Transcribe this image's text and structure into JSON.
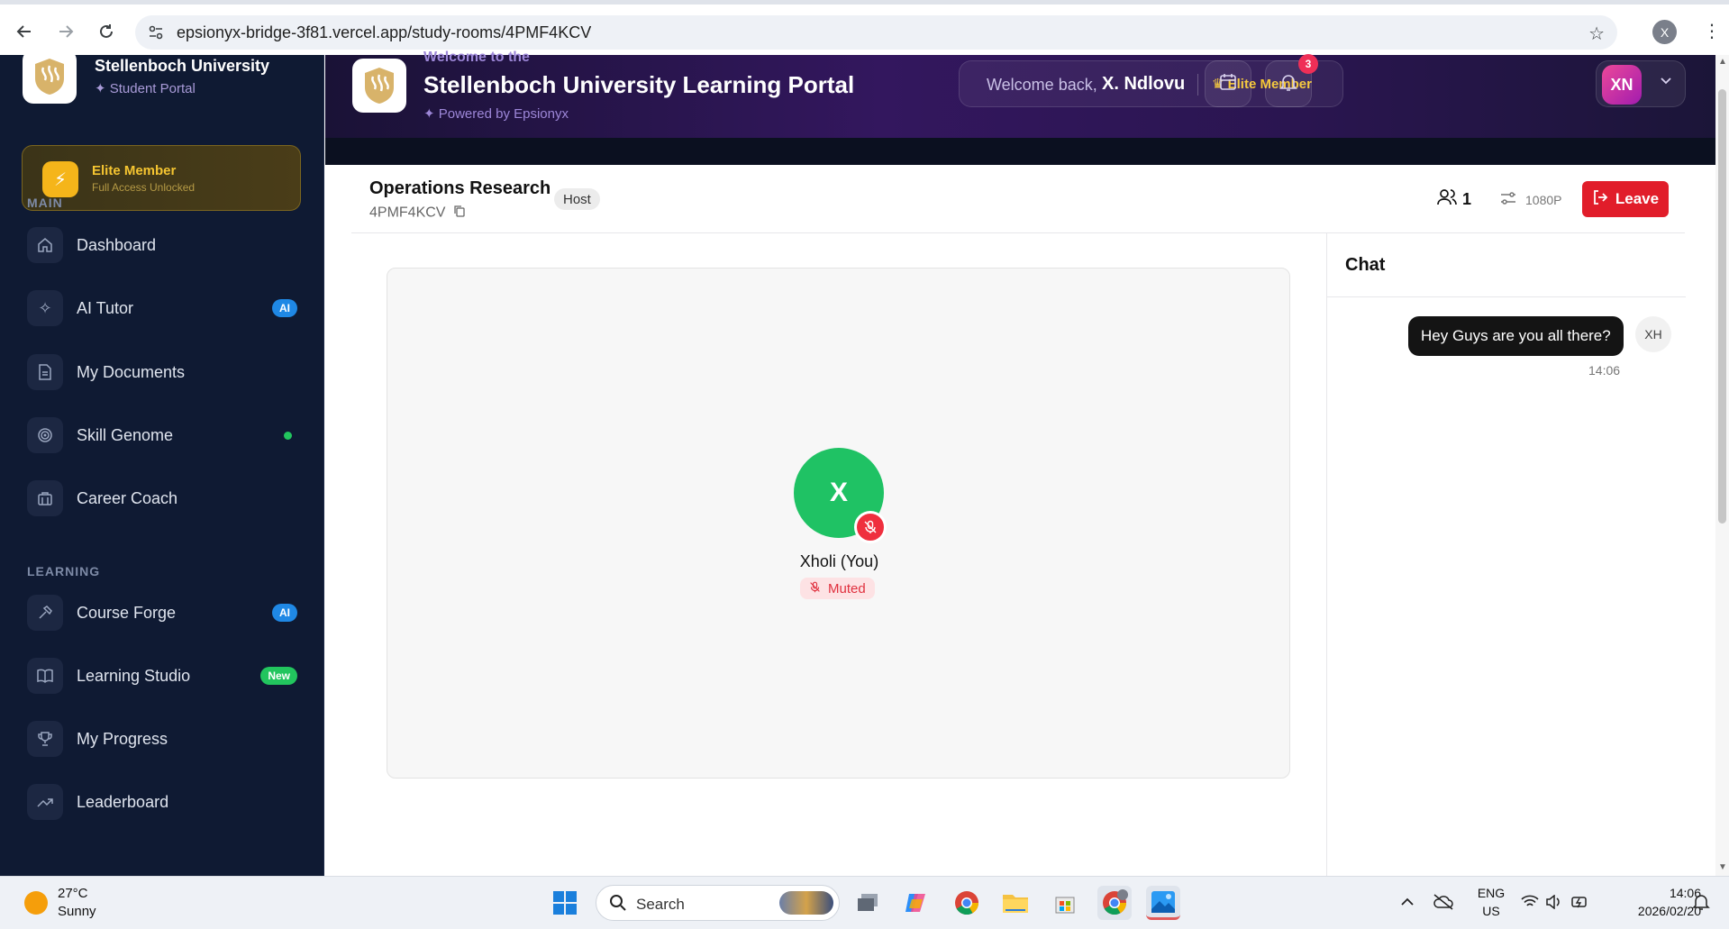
{
  "browser": {
    "url": "epsionyx-bridge-3f81.vercel.app/study-rooms/4PMF4KCV",
    "profile_initial": "X"
  },
  "sidebar": {
    "brand_title": "Stellenboch University",
    "brand_sub": "Student Portal",
    "elite_title": "Elite Member",
    "elite_sub": "Full Access Unlocked",
    "section_main": "MAIN",
    "section_learning": "LEARNING",
    "items": [
      {
        "label": "Dashboard",
        "icon": "home-icon"
      },
      {
        "label": "AI Tutor",
        "icon": "sparkles-icon",
        "badge": "AI"
      },
      {
        "label": "My Documents",
        "icon": "document-icon"
      },
      {
        "label": "Skill Genome",
        "icon": "target-icon"
      },
      {
        "label": "Career Coach",
        "icon": "briefcase-icon"
      },
      {
        "label": "Course Forge",
        "icon": "hammer-icon",
        "badge": "AI"
      },
      {
        "label": "Learning Studio",
        "icon": "book-icon",
        "badge": "New"
      },
      {
        "label": "My Progress",
        "icon": "trophy-icon"
      },
      {
        "label": "Leaderboard",
        "icon": "trending-icon"
      }
    ]
  },
  "header": {
    "kicker": "Welcome to the",
    "title": "Stellenboch University Learning Portal",
    "sub": "Powered by Epsionyx",
    "welcome_text": "Welcome back,",
    "welcome_name": "X. Ndlovu",
    "elite_label": "Elite Member",
    "notification_count": "3",
    "avatar_initials": "XN"
  },
  "room": {
    "title": "Operations Research",
    "code": "4PMF4KCV",
    "role_badge": "Host",
    "participant_count": "1",
    "quality": "1080P",
    "leave_label": "Leave"
  },
  "tile": {
    "initial": "X",
    "name": "Xholi (You)",
    "status": "Muted"
  },
  "chat": {
    "title": "Chat",
    "messages": [
      {
        "text": "Hey Guys are you all there?",
        "sender_initials": "XH",
        "time": "14:06"
      }
    ]
  },
  "taskbar": {
    "temperature": "27°C",
    "weather": "Sunny",
    "search_placeholder": "Search",
    "lang_top": "ENG",
    "lang_bottom": "US",
    "clock_time": "14:06",
    "clock_date": "2026/02/20"
  },
  "colors": {
    "sidebar_bg": "#0f1a33",
    "accent_gold": "#f5c531",
    "leave_red": "#e11d2a",
    "avatar_green": "#1fc264"
  }
}
